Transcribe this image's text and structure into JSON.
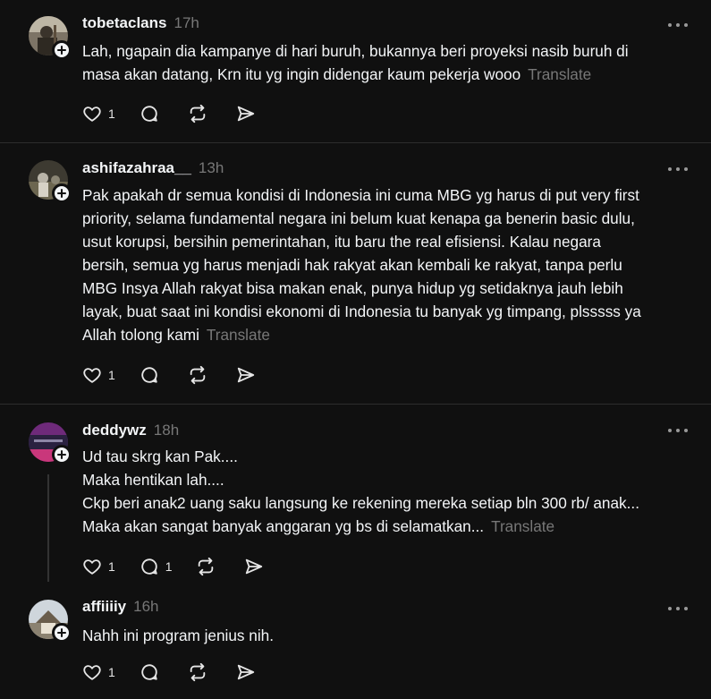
{
  "posts": [
    {
      "username": "tobetaclans",
      "time": "17h",
      "lines": [
        "Lah, ngapain dia kampanye di hari buruh, bukannya beri proyeksi nasib buruh di",
        "masa akan datang, Krn itu yg ingin didengar kaum pekerja wooo"
      ],
      "translate": "Translate",
      "likes": "1",
      "replies": ""
    },
    {
      "username": "ashifazahraa__",
      "time": "13h",
      "lines": [
        "Pak apakah dr semua kondisi di Indonesia ini cuma MBG yg harus di put very first",
        "priority, selama fundamental negara ini belum kuat kenapa ga benerin basic dulu,",
        "usut korupsi, bersihin pemerintahan, itu baru the real efisiensi. Kalau negara",
        "bersih, semua yg harus menjadi hak rakyat akan kembali ke rakyat, tanpa perlu",
        "MBG Insya Allah rakyat bisa makan enak, punya hidup yg setidaknya jauh lebih",
        "layak, buat saat ini kondisi ekonomi di Indonesia tu banyak yg timpang, plsssss ya",
        "Allah tolong kami"
      ],
      "translate": "Translate",
      "likes": "1",
      "replies": ""
    },
    {
      "username": "deddywz",
      "time": "18h",
      "lines": [
        "Ud tau skrg kan Pak....",
        "Maka hentikan lah....",
        "Ckp beri anak2 uang saku langsung ke rekening mereka setiap bln 300 rb/ anak...",
        "Maka akan sangat banyak anggaran yg bs di selamatkan..."
      ],
      "translate": "Translate",
      "likes": "1",
      "replies": "1"
    },
    {
      "username": "affiiiiy",
      "time": "16h",
      "lines": [
        "Nahh ini program jenius nih."
      ],
      "translate": "",
      "likes": "1",
      "replies": ""
    }
  ],
  "icons": {
    "like": "heart-icon",
    "reply": "comment-icon",
    "repost": "repost-icon",
    "share": "share-icon",
    "more": "more-icon",
    "follow": "plus-icon"
  },
  "colors": {
    "background": "#101010",
    "text": "#f3f5f7",
    "muted": "#777777",
    "divider": "#2d2d2d"
  }
}
